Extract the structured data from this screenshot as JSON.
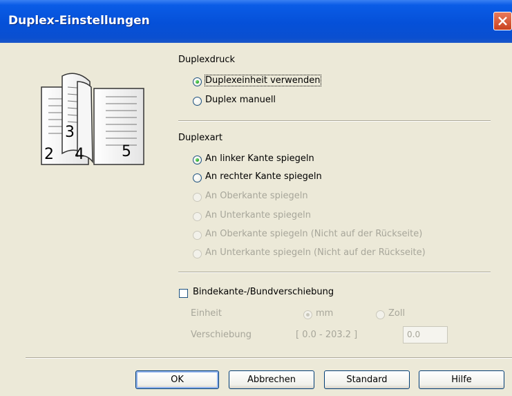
{
  "window": {
    "title": "Duplex-Einstellungen"
  },
  "illustration": {
    "page_numbers": [
      "2",
      "3",
      "4",
      "5"
    ]
  },
  "duplexdruck": {
    "heading": "Duplexdruck",
    "options": [
      {
        "label": "Duplexeinheit verwenden",
        "checked": true,
        "enabled": true
      },
      {
        "label": "Duplex manuell",
        "checked": false,
        "enabled": true
      }
    ]
  },
  "duplexart": {
    "heading": "Duplexart",
    "options": [
      {
        "label": "An linker Kante spiegeln",
        "checked": true,
        "enabled": true
      },
      {
        "label": "An rechter Kante spiegeln",
        "checked": false,
        "enabled": true
      },
      {
        "label": "An Oberkante spiegeln",
        "checked": false,
        "enabled": false
      },
      {
        "label": "An Unterkante spiegeln",
        "checked": false,
        "enabled": false
      },
      {
        "label": "An Oberkante spiegeln (Nicht auf der Rückseite)",
        "checked": false,
        "enabled": false
      },
      {
        "label": "An Unterkante spiegeln (Nicht auf der Rückseite)",
        "checked": false,
        "enabled": false
      }
    ]
  },
  "binding": {
    "checkbox_label": "Bindekante-/Bundverschiebung",
    "checked": false,
    "unit_label": "Einheit",
    "unit_options": [
      {
        "label": "mm",
        "checked": true
      },
      {
        "label": "Zoll",
        "checked": false
      }
    ],
    "offset_label": "Verschiebung",
    "range": "[ 0.0 - 203.2 ]",
    "offset_value": "0.0"
  },
  "buttons": {
    "ok": "OK",
    "cancel": "Abbrechen",
    "standard": "Standard",
    "help": "Hilfe"
  }
}
